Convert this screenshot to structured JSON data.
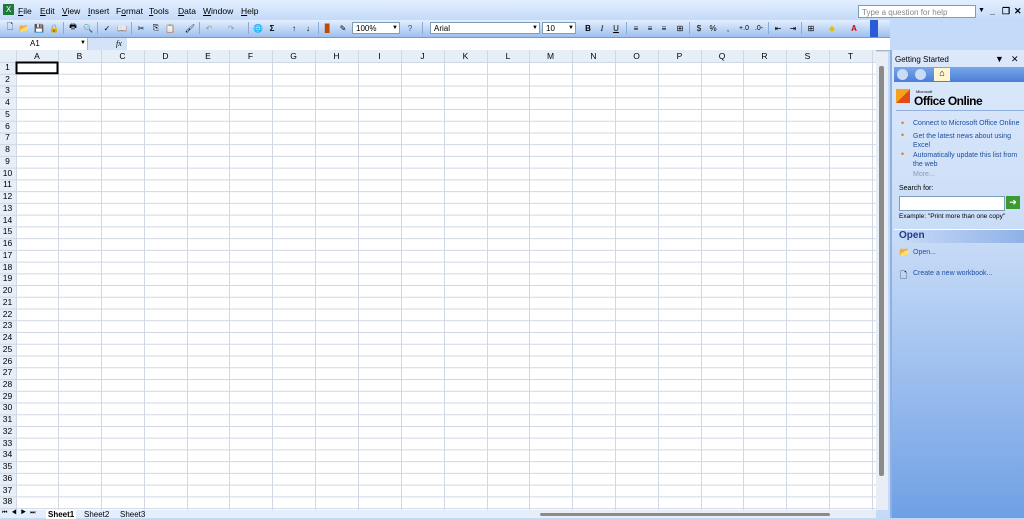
{
  "menu": [
    "File",
    "Edit",
    "View",
    "Insert",
    "Format",
    "Tools",
    "Data",
    "Window",
    "Help"
  ],
  "menu_underline": [
    "F",
    "E",
    "V",
    "I",
    "o",
    "T",
    "D",
    "W",
    "H"
  ],
  "help_placeholder": "Type a question for help",
  "toolbar": {
    "zoom": "100%",
    "font": "Arial",
    "size": "10",
    "autosum": "Σ",
    "bold": "B",
    "italic": "I",
    "underline": "U",
    "percent": "%"
  },
  "name_box": "A1",
  "fx": "fx",
  "columns": [
    "A",
    "B",
    "C",
    "D",
    "E",
    "F",
    "G",
    "H",
    "I",
    "J",
    "K",
    "L",
    "M",
    "N",
    "O",
    "P",
    "Q",
    "R",
    "S",
    "T"
  ],
  "rows": [
    "1",
    "2",
    "3",
    "4",
    "5",
    "6",
    "7",
    "8",
    "9",
    "10",
    "11",
    "12",
    "13",
    "14",
    "15",
    "16",
    "17",
    "18",
    "19",
    "20",
    "21",
    "22",
    "23",
    "24",
    "25",
    "26",
    "27",
    "28",
    "29",
    "30",
    "31",
    "32",
    "33",
    "34",
    "35",
    "36",
    "37",
    "38"
  ],
  "sheets": [
    "Sheet1",
    "Sheet2",
    "Sheet3"
  ],
  "taskpane": {
    "title": "Getting Started",
    "logo_small": "Microsoft",
    "logo": "Office Online",
    "links": [
      "Connect to Microsoft Office Online",
      "Get the latest news about using Excel",
      "Automatically update this list from the web"
    ],
    "more": "More...",
    "search_label": "Search for:",
    "example": "Example:  \"Print more than one copy\"",
    "open_title": "Open",
    "open_link": "Open...",
    "new_link": "Create a new workbook..."
  },
  "colors": {
    "accent": "#c3daf9",
    "brand_orange": "#e07a14",
    "link": "#1e4fa0"
  }
}
